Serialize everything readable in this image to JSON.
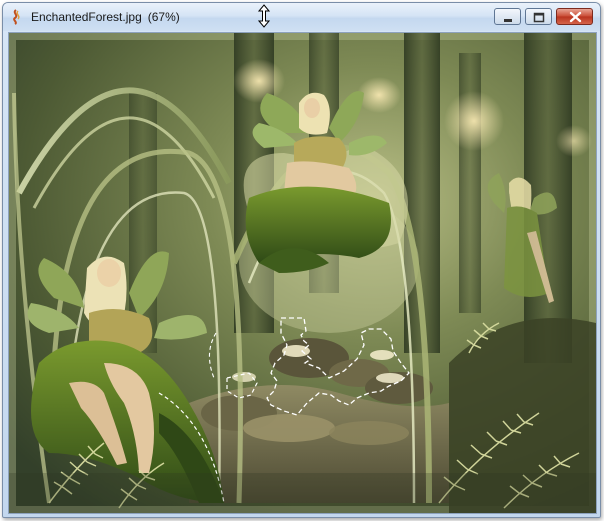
{
  "window": {
    "title": "EnchantedForest.jpg",
    "zoom": "(67%)",
    "buttons": {
      "minimize": "minimize",
      "maximize": "maximize",
      "close": "close"
    }
  },
  "icons": {
    "app": "paint-app-icon",
    "cursor": "vertical-resize-cursor-icon",
    "minimize": "minimize-icon",
    "maximize": "maximize-icon",
    "close": "close-icon"
  },
  "colors": {
    "titlebar": "#d5e4f5",
    "close_button": "#c94a33",
    "forest_dark": "#3f4a2c",
    "forest_light": "#c8cf9a",
    "selection": "#ffffff"
  }
}
